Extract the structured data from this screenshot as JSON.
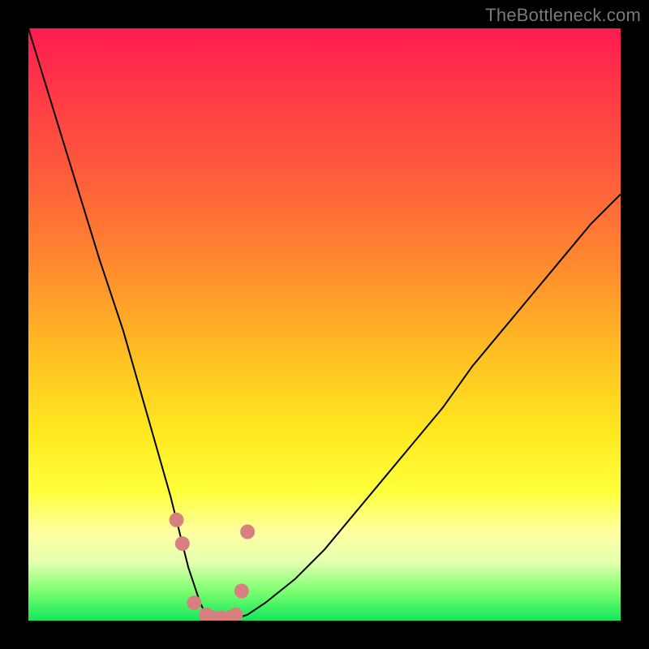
{
  "watermark": {
    "text": "TheBottleneck.com"
  },
  "chart_data": {
    "type": "line",
    "title": "",
    "xlabel": "",
    "ylabel": "",
    "xlim": [
      0,
      100
    ],
    "ylim": [
      0,
      100
    ],
    "grid": false,
    "legend": false,
    "background_gradient": {
      "orientation": "vertical",
      "stops": [
        {
          "pos": 0.0,
          "color": "#ff1a52"
        },
        {
          "pos": 0.24,
          "color": "#ff5a3c"
        },
        {
          "pos": 0.55,
          "color": "#ffbf22"
        },
        {
          "pos": 0.78,
          "color": "#ffff3a"
        },
        {
          "pos": 0.95,
          "color": "#7cff70"
        },
        {
          "pos": 1.0,
          "color": "#12e85a"
        }
      ]
    },
    "series": [
      {
        "name": "bottleneck-curve",
        "color": "#000000",
        "x": [
          0,
          4,
          8,
          12,
          16,
          18,
          20,
          22,
          24,
          25,
          26,
          27,
          28,
          29,
          30,
          31,
          32,
          34,
          37,
          40,
          45,
          50,
          55,
          60,
          65,
          70,
          75,
          80,
          85,
          90,
          95,
          100
        ],
        "y": [
          100,
          87,
          74,
          61,
          49,
          42,
          35,
          28,
          21,
          17,
          13,
          9,
          6,
          3,
          1,
          0,
          0,
          0,
          1,
          3,
          7,
          12,
          18,
          24,
          30,
          36,
          43,
          49,
          55,
          61,
          67,
          72
        ]
      }
    ],
    "markers": [
      {
        "name": "valley-points",
        "shape": "circle",
        "color": "#d88080",
        "size": 4.5,
        "x": [
          25,
          26,
          28,
          30,
          31,
          32.5,
          34,
          35,
          36,
          37
        ],
        "y": [
          17,
          13,
          3,
          1,
          0.5,
          0.5,
          0.5,
          1,
          5,
          15
        ]
      }
    ]
  }
}
